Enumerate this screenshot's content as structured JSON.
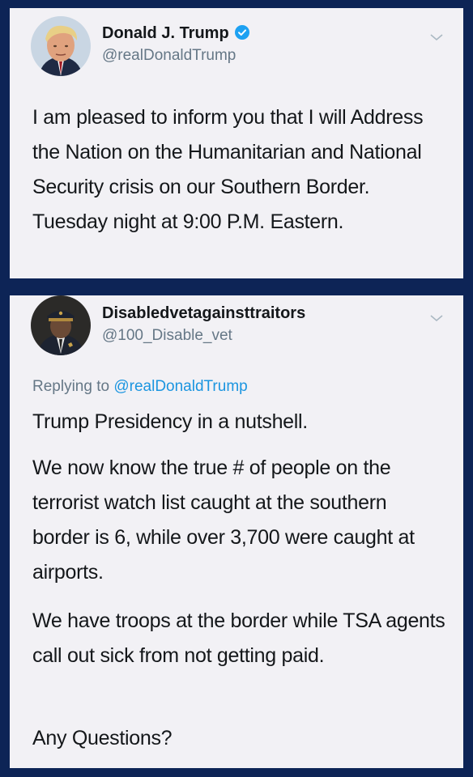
{
  "tweet1": {
    "display_name": "Donald J. Trump",
    "handle": "@realDonaldTrump",
    "verified": true,
    "text": "I am pleased to inform you that I will Address the Nation on the Humanitarian and National Security crisis on our Southern Border. Tuesday night at 9:00 P.M. Eastern.",
    "avatar_icon": "profile-photo"
  },
  "tweet2": {
    "display_name": "Disabledvetagainsttraitors",
    "handle": "@100_Disable_vet",
    "replying_prefix": "Replying to",
    "replying_to": "@realDonaldTrump",
    "paragraphs": [
      "Trump Presidency in a nutshell.",
      "We now know the true # of people on the terrorist watch list caught at the southern border is 6, while over 3,700 were caught at airports.",
      "We have troops at the border while TSA agents call out sick from not getting paid.",
      "Any Questions?"
    ],
    "avatar_icon": "profile-photo"
  },
  "colors": {
    "background": "#0d2456",
    "card": "#f2f1f5",
    "text": "#14171a",
    "secondary": "#657786",
    "link": "#1b95e0",
    "verified": "#1da1f2"
  }
}
